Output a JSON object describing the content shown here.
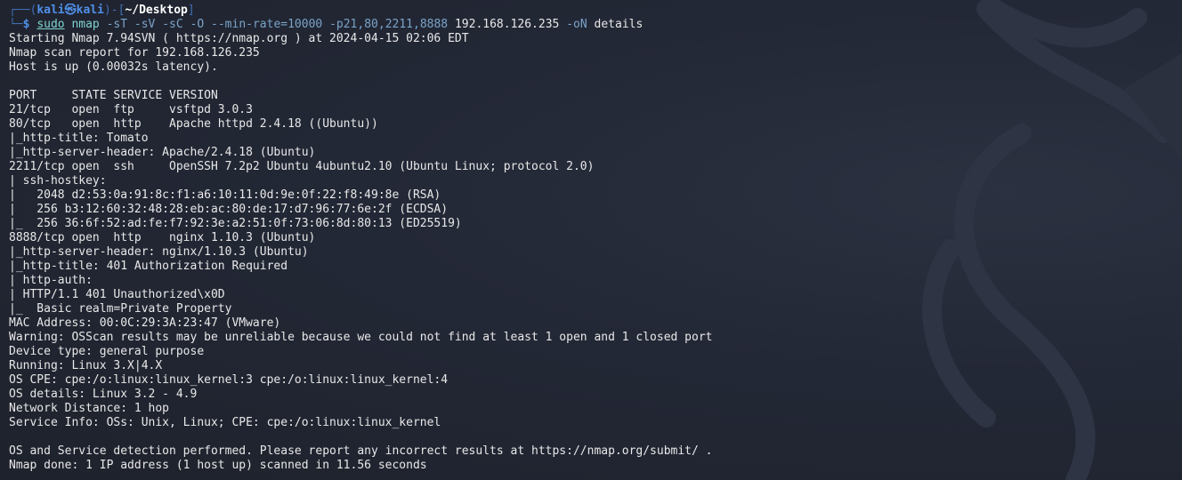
{
  "prompt": {
    "frame_left": "┌──(",
    "user_host": "kali㉿kali",
    "frame_mid": ")-[",
    "path": "~/Desktop",
    "frame_right": "]",
    "frame_bottom": "└─",
    "dollar": "$"
  },
  "command": {
    "sudo": "sudo",
    "program": "nmap",
    "opt1": "-sT",
    "opt2": "-sV",
    "opt3": "-sC",
    "opt4": "-O",
    "opt5": "--min-rate=10000",
    "opt6": "-p21,80,2211,8888",
    "target": "192.168.126.235",
    "opt7": "-oN",
    "outfile": "details"
  },
  "output": [
    "Starting Nmap 7.94SVN ( https://nmap.org ) at 2024-04-15 02:06 EDT",
    "Nmap scan report for 192.168.126.235",
    "Host is up (0.00032s latency).",
    "",
    "PORT     STATE SERVICE VERSION",
    "21/tcp   open  ftp     vsftpd 3.0.3",
    "80/tcp   open  http    Apache httpd 2.4.18 ((Ubuntu))",
    "|_http-title: Tomato",
    "|_http-server-header: Apache/2.4.18 (Ubuntu)",
    "2211/tcp open  ssh     OpenSSH 7.2p2 Ubuntu 4ubuntu2.10 (Ubuntu Linux; protocol 2.0)",
    "| ssh-hostkey: ",
    "|   2048 d2:53:0a:91:8c:f1:a6:10:11:0d:9e:0f:22:f8:49:8e (RSA)",
    "|   256 b3:12:60:32:48:28:eb:ac:80:de:17:d7:96:77:6e:2f (ECDSA)",
    "|_  256 36:6f:52:ad:fe:f7:92:3e:a2:51:0f:73:06:8d:80:13 (ED25519)",
    "8888/tcp open  http    nginx 1.10.3 (Ubuntu)",
    "|_http-server-header: nginx/1.10.3 (Ubuntu)",
    "|_http-title: 401 Authorization Required",
    "| http-auth: ",
    "| HTTP/1.1 401 Unauthorized\\x0D",
    "|_  Basic realm=Private Property",
    "MAC Address: 00:0C:29:3A:23:47 (VMware)",
    "Warning: OSScan results may be unreliable because we could not find at least 1 open and 1 closed port",
    "Device type: general purpose",
    "Running: Linux 3.X|4.X",
    "OS CPE: cpe:/o:linux:linux_kernel:3 cpe:/o:linux:linux_kernel:4",
    "OS details: Linux 3.2 - 4.9",
    "Network Distance: 1 hop",
    "Service Info: OSs: Unix, Linux; CPE: cpe:/o:linux:linux_kernel",
    "",
    "OS and Service detection performed. Please report any incorrect results at https://nmap.org/submit/ .",
    "Nmap done: 1 IP address (1 host up) scanned in 11.56 seconds"
  ],
  "colors": {
    "background": "#1f2430",
    "text": "#e8e8e8",
    "prompt_blue": "#4f8fe8",
    "command_cyan": "#7fd3d0"
  }
}
